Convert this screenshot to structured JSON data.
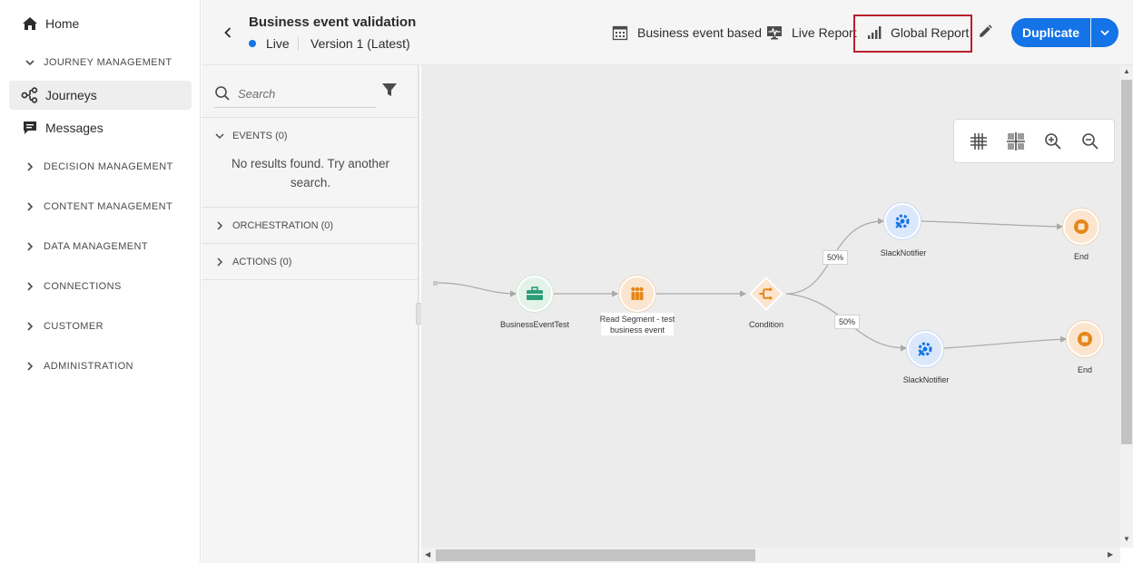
{
  "nav": {
    "home": "Home",
    "journey_management": "JOURNEY MANAGEMENT",
    "journeys": "Journeys",
    "messages": "Messages",
    "sections": [
      "DECISION MANAGEMENT",
      "CONTENT MANAGEMENT",
      "DATA MANAGEMENT",
      "CONNECTIONS",
      "CUSTOMER",
      "ADMINISTRATION"
    ]
  },
  "header": {
    "title": "Business event validation",
    "status": "Live",
    "version": "Version 1 (Latest)",
    "business_event_based": "Business event based",
    "live_report": "Live Report",
    "global_report": "Global Report",
    "duplicate": "Duplicate"
  },
  "palette": {
    "search_placeholder": "Search",
    "events": "EVENTS (0)",
    "no_results": "No results found. Try another search.",
    "orchestration": "ORCHESTRATION (0)",
    "actions": "ACTIONS (0)"
  },
  "canvas": {
    "nodes": {
      "business_event": "BusinessEventTest",
      "read_segment_line1": "Read Segment - test",
      "read_segment_line2": "business event",
      "condition": "Condition",
      "slack_top": "SlackNotifier",
      "end_top": "End",
      "slack_bottom": "SlackNotifier",
      "end_bottom": "End"
    },
    "split_top": "50%",
    "split_bottom": "50%"
  },
  "colors": {
    "accent": "#1473e6",
    "highlight": "#b7202a",
    "event_node": "#e3f3ea",
    "segment_node": "#fbe5cf",
    "action_node": "#dbe8fb",
    "end_node": "#fbe5cf"
  }
}
